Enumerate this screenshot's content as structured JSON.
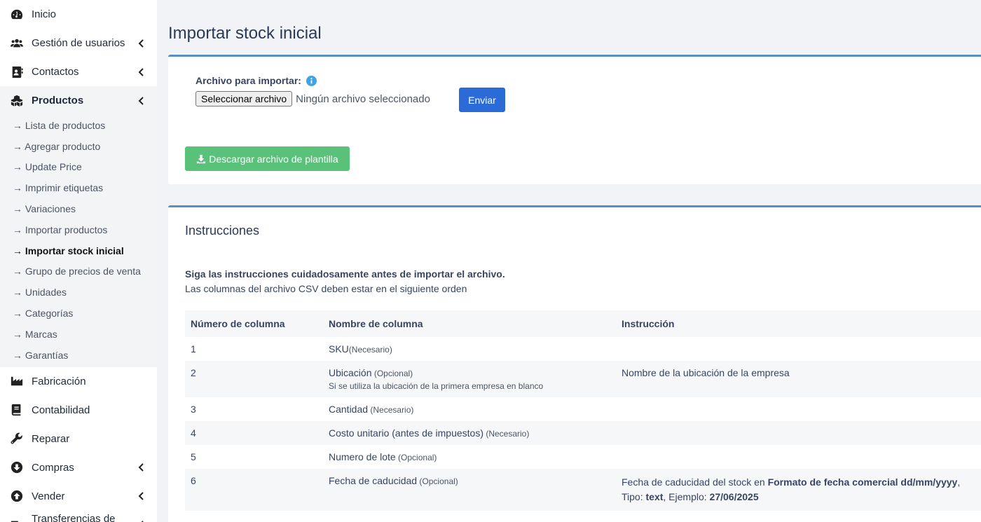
{
  "sidebar": {
    "items_top": [
      {
        "label": "Inicio",
        "icon": "dashboard-icon",
        "chevron": false
      },
      {
        "label": "Gestión de usuarios",
        "icon": "users-icon",
        "chevron": true
      },
      {
        "label": "Contactos",
        "icon": "address-book-icon",
        "chevron": true
      },
      {
        "label": "Productos",
        "icon": "cubes-icon",
        "chevron": true
      }
    ],
    "submenu": [
      "→ Lista de productos",
      "→ Agregar producto",
      "→ Update Price",
      "→ Imprimir etiquetas",
      "→ Variaciones",
      "→ Importar productos",
      "→ Importar stock inicial",
      "→ Grupo de precios de venta",
      "→ Unidades",
      "→ Categorías",
      "→ Marcas",
      "→ Garantías"
    ],
    "items_bottom": [
      {
        "label": "Fabricación",
        "icon": "industry-icon",
        "chevron": false
      },
      {
        "label": "Contabilidad",
        "icon": "book-icon",
        "chevron": false
      },
      {
        "label": "Reparar",
        "icon": "wrench-icon",
        "chevron": false
      },
      {
        "label": "Compras",
        "icon": "arrow-circle-down-icon",
        "chevron": true
      },
      {
        "label": "Vender",
        "icon": "arrow-circle-up-icon",
        "chevron": true
      },
      {
        "label": "Transferencias de stock",
        "icon": "truck-icon",
        "chevron": true
      }
    ]
  },
  "page": {
    "title": "Importar stock inicial"
  },
  "upload": {
    "label": "Archivo para importar:",
    "file_button": "Seleccionar archivo",
    "no_file": "Ningún archivo seleccionado",
    "submit": "Enviar",
    "download": "Descargar archivo de plantilla"
  },
  "instructions": {
    "title": "Instrucciones",
    "bold": "Siga las instrucciones cuidadosamente antes de importar el archivo.",
    "line": "Las columnas del archivo CSV deben estar en el siguiente orden",
    "headers": [
      "Número de columna",
      "Nombre de columna",
      "Instrucción"
    ],
    "rows": [
      {
        "num": "1",
        "name": "SKU",
        "tag": "(Necesario)",
        "hint": "",
        "instr": ""
      },
      {
        "num": "2",
        "name": "Ubicación",
        "tag": " (Opcional)",
        "hint": "Si se utiliza la ubicación de la primera empresa en blanco",
        "instr": "Nombre de la ubicación de la empresa"
      },
      {
        "num": "3",
        "name": "Cantidad",
        "tag": " (Necesario)",
        "hint": "",
        "instr": ""
      },
      {
        "num": "4",
        "name": "Costo unitario (antes de impuestos)",
        "tag": " (Necesario)",
        "hint": "",
        "instr": ""
      },
      {
        "num": "5",
        "name": "Numero de lote",
        "tag": " (Opcional)",
        "hint": "",
        "instr": ""
      },
      {
        "num": "6",
        "name": "Fecha de caducidad",
        "tag": " (Opcional)",
        "hint": "",
        "instr": ""
      }
    ],
    "row6_instr": {
      "p1": "Fecha de caducidad del stock en ",
      "b1": "Formato de fecha comercial dd/mm/yyyy",
      "p2": ", Tipo: ",
      "b2": "text",
      "p3": ", Ejemplo: ",
      "b3": "27/06/2025"
    }
  },
  "colors": {
    "primary": "#2a6bd8",
    "success": "#59c17a",
    "card_border": "#5b8fc2"
  }
}
